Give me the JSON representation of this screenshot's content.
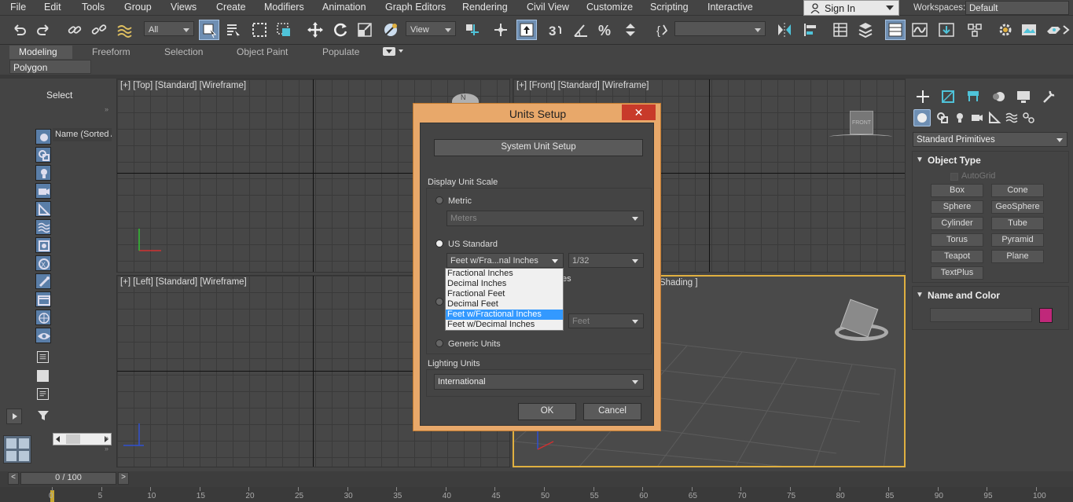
{
  "menu": {
    "items": [
      "File",
      "Edit",
      "Tools",
      "Group",
      "Views",
      "Create",
      "Modifiers",
      "Animation",
      "Graph Editors",
      "Rendering",
      "Civil View",
      "Customize",
      "Scripting",
      "Interactive"
    ]
  },
  "account": {
    "signin_label": "Sign In"
  },
  "workspace": {
    "label": "Workspaces:",
    "value": "Default"
  },
  "toolbar": {
    "filter_value": "All",
    "refcoord_value": "View"
  },
  "ribbon": {
    "tabs": [
      "Modeling",
      "Freeform",
      "Selection",
      "Object Paint",
      "Populate"
    ],
    "active_tab": "Modeling",
    "panel_label": "Polygon Modeling"
  },
  "scene_explorer": {
    "select_label": "Select",
    "column_header": "Name (Sorted A"
  },
  "viewports": {
    "top": "[+] [Top] [Standard] [Wireframe]",
    "front": "[+] [Front] [Standard] [Wireframe]",
    "left": "[+] [Left] [Standard] [Wireframe]",
    "perspective": "lt Shading ]",
    "viewcube_front": "FRONT",
    "compass_n": "N"
  },
  "command_panel": {
    "category": "Standard Primitives",
    "rollout_object_type": "Object Type",
    "autogrid_label": "AutoGrid",
    "buttons": [
      "Box",
      "Cone",
      "Sphere",
      "GeoSphere",
      "Cylinder",
      "Tube",
      "Torus",
      "Pyramid",
      "Teapot",
      "Plane",
      "TextPlus"
    ],
    "rollout_name_color": "Name and Color",
    "object_color": "#c0287a"
  },
  "timeline": {
    "frame_display": "0 / 100",
    "ticks": [
      "0",
      "5",
      "10",
      "15",
      "20",
      "25",
      "30",
      "35",
      "40",
      "45",
      "50",
      "55",
      "60",
      "65",
      "70",
      "75",
      "80",
      "85",
      "90",
      "95",
      "100"
    ]
  },
  "dialog": {
    "title": "Units Setup",
    "system_unit_button": "System Unit Setup",
    "display_unit_scale_label": "Display Unit Scale",
    "metric_label": "Metric",
    "metric_value": "Meters",
    "us_standard_label": "US Standard",
    "us_standard_value": "Feet w/Fra...nal Inches",
    "fraction_value": "1/32",
    "default_units_partial": "es",
    "custom_value": "Feet",
    "generic_units_label": "Generic Units",
    "lighting_units_label": "Lighting Units",
    "lighting_units_value": "International",
    "ok_label": "OK",
    "cancel_label": "Cancel",
    "us_options": [
      "Fractional Inches",
      "Decimal Inches",
      "Fractional Feet",
      "Decimal Feet",
      "Feet w/Fractional Inches",
      "Feet w/Decimal Inches"
    ],
    "highlighted_option": "Feet w/Fractional Inches"
  },
  "colors": {
    "dialog_frame": "#e8a86a",
    "close_button": "#c83a2a",
    "active_tool": "#6f8fb3",
    "highlight": "#3399ff",
    "active_viewport_border": "#e0b040"
  }
}
